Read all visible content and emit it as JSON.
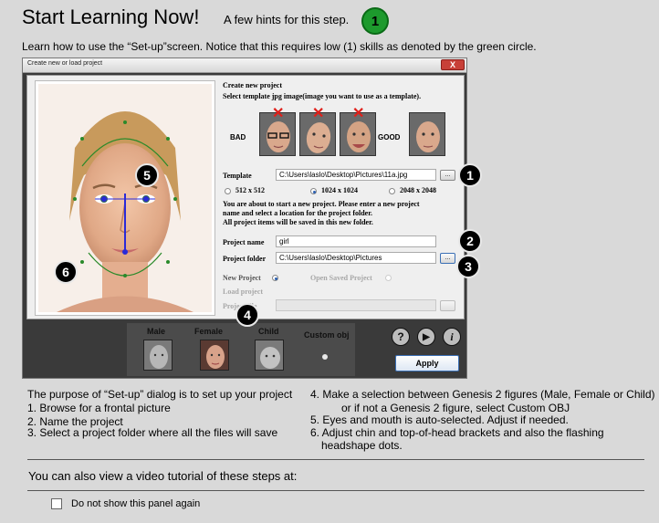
{
  "header": {
    "title": "Start Learning Now!",
    "hint": "A few hints for this step.",
    "skill_level": "1",
    "intro": "Learn how to use the “Set-up”screen. Notice that this requires low (1) skills as denoted by the green circle."
  },
  "dialog": {
    "title": "Create new or load project",
    "close_label": "X",
    "create_heading": "Create new project",
    "template_instruction": "Select template jpg image(image you want to use as a template).",
    "bad_label": "BAD",
    "good_label": "GOOD",
    "template_label": "Template",
    "template_value": "C:\\Users\\laslo\\Desktop\\Pictures\\11a.jpg",
    "browse_label": "...",
    "resolutions": [
      {
        "label": "512 x 512",
        "selected": false
      },
      {
        "label": "1024 x 1024",
        "selected": true
      },
      {
        "label": "2048 x 2048",
        "selected": false
      }
    ],
    "notice_lines": [
      "You are about to start a new project. Please enter a new project",
      "name and select a location for the project folder.",
      "All project items will be saved in this new folder."
    ],
    "project_name_label": "Project name",
    "project_name_value": "girl",
    "project_folder_label": "Project folder",
    "project_folder_value": "C:\\Users\\laslo\\Desktop\\Pictures",
    "new_project_label": "New Project",
    "open_saved_label": "Open Saved Project",
    "load_heading": "Load project",
    "project_file_label": "Project file",
    "figures": {
      "male": "Male",
      "female": "Female",
      "child": "Child",
      "custom": "Custom obj"
    },
    "help_symbol": "?",
    "play_symbol": "▶",
    "info_symbol": "i",
    "apply_label": "Apply"
  },
  "callouts": [
    "1",
    "2",
    "3",
    "4",
    "5",
    "6"
  ],
  "instructions": {
    "left": [
      "The purpose of “Set-up” dialog is to set up your project",
      "1. Browse for a frontal picture",
      "2. Name the project",
      "3. Select a project folder where all the files will save"
    ],
    "right": [
      "4. Make a selection between Genesis 2 figures (Male, Female or Child)",
      "or if not a Genesis 2 figure, select Custom OBJ",
      "5. Eyes and mouth is auto-selected. Adjust if needed.",
      "6. Adjust chin and top-of-head brackets and also the flashing",
      "headshape dots."
    ]
  },
  "footer": {
    "video_text": "You can also view a video tutorial of these steps at:",
    "dont_show_label": "Do not show this panel again"
  },
  "colors": {
    "skill_badge": "#1d9a2d",
    "callout": "#000000",
    "apply_border": "#3a6fb5",
    "reject_mark": "#e0201a"
  }
}
